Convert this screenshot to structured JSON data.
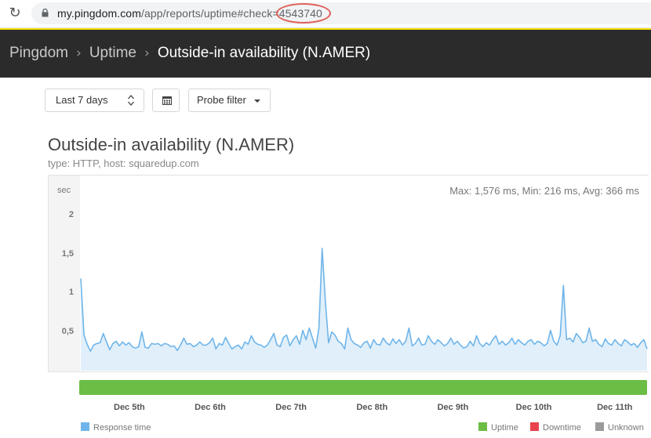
{
  "browser": {
    "url_prefix": "my.pingdom.com",
    "url_path": "/app/reports/uptime#check",
    "url_highlight": "=4543740"
  },
  "breadcrumb": {
    "items": [
      "Pingdom",
      "Uptime"
    ],
    "current": "Outside-in availability (N.AMER)"
  },
  "controls": {
    "date_range": "Last 7 days",
    "probe_filter": "Probe filter"
  },
  "report": {
    "title": "Outside-in availability (N.AMER)",
    "subtitle": "type: HTTP, host: squaredup.com"
  },
  "chart_data": {
    "type": "area",
    "y_unit": "sec",
    "ylim": [
      0,
      2.5
    ],
    "y_ticks": [
      "0,5",
      "1",
      "1,5",
      "2"
    ],
    "y_tick_values": [
      0.5,
      1,
      1.5,
      2
    ],
    "stats": "Max: 1,576 ms, Min: 216 ms, Avg: 366 ms",
    "x_ticks": [
      "Dec 5th",
      "Dec 6th",
      "Dec 7th",
      "Dec 8th",
      "Dec 9th",
      "Dec 10th",
      "Dec 11th"
    ],
    "x_tick_pos": [
      0.6,
      1.6,
      2.6,
      3.6,
      4.6,
      5.6,
      6.6
    ],
    "x_range": [
      0,
      7
    ],
    "series": [
      {
        "name": "Response time",
        "color": "#6fb5ea",
        "values": [
          1.19,
          0.46,
          0.34,
          0.25,
          0.33,
          0.35,
          0.36,
          0.48,
          0.37,
          0.27,
          0.35,
          0.38,
          0.32,
          0.37,
          0.33,
          0.36,
          0.31,
          0.29,
          0.31,
          0.5,
          0.3,
          0.29,
          0.35,
          0.34,
          0.35,
          0.32,
          0.35,
          0.34,
          0.31,
          0.32,
          0.26,
          0.33,
          0.42,
          0.34,
          0.35,
          0.31,
          0.33,
          0.37,
          0.33,
          0.33,
          0.36,
          0.42,
          0.28,
          0.35,
          0.33,
          0.43,
          0.35,
          0.28,
          0.31,
          0.33,
          0.28,
          0.37,
          0.34,
          0.45,
          0.37,
          0.34,
          0.33,
          0.3,
          0.33,
          0.4,
          0.48,
          0.33,
          0.31,
          0.43,
          0.46,
          0.32,
          0.4,
          0.45,
          0.34,
          0.52,
          0.4,
          0.55,
          0.42,
          0.29,
          0.55,
          1.58,
          0.9,
          0.36,
          0.5,
          0.46,
          0.38,
          0.35,
          0.28,
          0.55,
          0.4,
          0.35,
          0.33,
          0.3,
          0.36,
          0.38,
          0.29,
          0.4,
          0.34,
          0.33,
          0.42,
          0.36,
          0.33,
          0.41,
          0.35,
          0.4,
          0.33,
          0.38,
          0.55,
          0.32,
          0.35,
          0.42,
          0.33,
          0.34,
          0.45,
          0.38,
          0.34,
          0.4,
          0.36,
          0.32,
          0.35,
          0.42,
          0.34,
          0.38,
          0.33,
          0.29,
          0.31,
          0.38,
          0.32,
          0.45,
          0.35,
          0.31,
          0.36,
          0.33,
          0.4,
          0.45,
          0.34,
          0.38,
          0.33,
          0.36,
          0.42,
          0.34,
          0.4,
          0.36,
          0.33,
          0.38,
          0.4,
          0.34,
          0.38,
          0.36,
          0.32,
          0.35,
          0.52,
          0.38,
          0.33,
          0.45,
          1.1,
          0.4,
          0.42,
          0.37,
          0.48,
          0.43,
          0.36,
          0.38,
          0.55,
          0.38,
          0.4,
          0.34,
          0.31,
          0.41,
          0.35,
          0.33,
          0.4,
          0.35,
          0.32,
          0.4,
          0.37,
          0.33,
          0.35,
          0.3,
          0.36,
          0.4,
          0.28
        ]
      }
    ]
  },
  "legend": {
    "response_time": "Response time",
    "uptime": "Uptime",
    "downtime": "Downtime",
    "unknown": "Unknown",
    "colors": {
      "response_time": "#6fb5ea",
      "uptime": "#6bbd45",
      "downtime": "#e8434c",
      "unknown": "#9a9a9a"
    }
  },
  "status": {
    "state": "Uptime",
    "color": "#6bbd45"
  }
}
